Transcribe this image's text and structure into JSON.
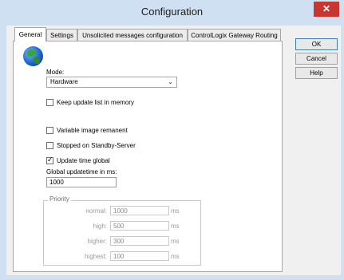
{
  "window": {
    "title": "Configuration",
    "close_symbol": "✕"
  },
  "tabs": [
    {
      "label": "General",
      "active": true
    },
    {
      "label": "Settings",
      "active": false
    },
    {
      "label": "Unsolicited messages configuration",
      "active": false
    },
    {
      "label": "ControlLogix Gateway Routing",
      "active": false
    }
  ],
  "buttons": {
    "ok": "OK",
    "cancel": "Cancel",
    "help": "Help"
  },
  "general": {
    "mode_label": "Mode:",
    "mode_value": "Hardware",
    "keep_update_list": {
      "label": "Keep update list in memory",
      "checked": false
    },
    "variable_image_remanent": {
      "label": "Variable image remanent",
      "checked": false
    },
    "stopped_on_standby": {
      "label": "Stopped on Standby-Server",
      "checked": false
    },
    "update_time_global": {
      "label": "Update time global",
      "checked": true
    },
    "global_updatetime_label": "Global updatetime in ms:",
    "global_updatetime_value": "1000",
    "priority": {
      "title": "Priority",
      "rows": [
        {
          "label": "normal:",
          "value": "1000",
          "unit": "ms"
        },
        {
          "label": "high:",
          "value": "500",
          "unit": "ms"
        },
        {
          "label": "higher:",
          "value": "300",
          "unit": "ms"
        },
        {
          "label": "highest:",
          "value": "100",
          "unit": "ms"
        }
      ]
    }
  },
  "icons": {
    "app_icon": "globe-icon",
    "dropdown_caret": "chevron-down-icon"
  },
  "colors": {
    "titlebar": "#cfe0f3",
    "close_button": "#c7372f",
    "dialog_bg": "#f0f0f0"
  }
}
